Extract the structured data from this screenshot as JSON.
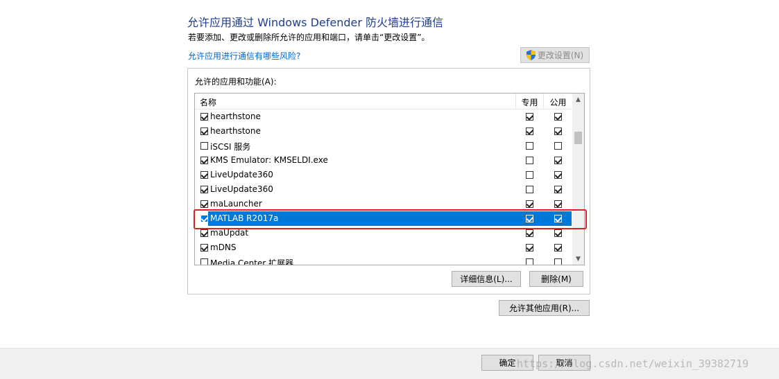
{
  "header": {
    "title": "允许应用通过 Windows Defender 防火墙进行通信",
    "description": "若要添加、更改或删除所允许的应用和端口，请单击“更改设置”。",
    "risk_link": "允许应用进行通信有哪些风险?",
    "change_settings_label": "更改设置(N)"
  },
  "group": {
    "label": "允许的应用和功能(A):",
    "columns": {
      "name": "名称",
      "private": "专用",
      "public": "公用"
    },
    "rows": [
      {
        "name": "hearthstone",
        "enabled": true,
        "private": true,
        "public": true,
        "selected": false
      },
      {
        "name": "hearthstone",
        "enabled": true,
        "private": true,
        "public": true,
        "selected": false
      },
      {
        "name": "iSCSI 服务",
        "enabled": false,
        "private": false,
        "public": false,
        "selected": false
      },
      {
        "name": "KMS Emulator: KMSELDI.exe",
        "enabled": true,
        "private": false,
        "public": true,
        "selected": false
      },
      {
        "name": "LiveUpdate360",
        "enabled": true,
        "private": false,
        "public": true,
        "selected": false
      },
      {
        "name": "LiveUpdate360",
        "enabled": true,
        "private": false,
        "public": true,
        "selected": false
      },
      {
        "name": "maLauncher",
        "enabled": true,
        "private": true,
        "public": true,
        "selected": false
      },
      {
        "name": "MATLAB R2017a",
        "enabled": true,
        "private": true,
        "public": true,
        "selected": true
      },
      {
        "name": "maUpdat",
        "enabled": true,
        "private": true,
        "public": true,
        "selected": false
      },
      {
        "name": "mDNS",
        "enabled": true,
        "private": true,
        "public": true,
        "selected": false
      },
      {
        "name": "Media Center 扩展器",
        "enabled": false,
        "private": false,
        "public": false,
        "selected": false
      }
    ],
    "details_button": "详细信息(L)...",
    "delete_button": "删除(M)"
  },
  "allow_other_button": "允许其他应用(R)...",
  "footer": {
    "ok_label": "确定",
    "cancel_label": "取消"
  },
  "watermark": "https://blog.csdn.net/weixin_39382719",
  "colors": {
    "selection": "#0078d7",
    "title": "#1e3d8f",
    "link": "#0066cc",
    "highlight_border": "#e02020"
  }
}
